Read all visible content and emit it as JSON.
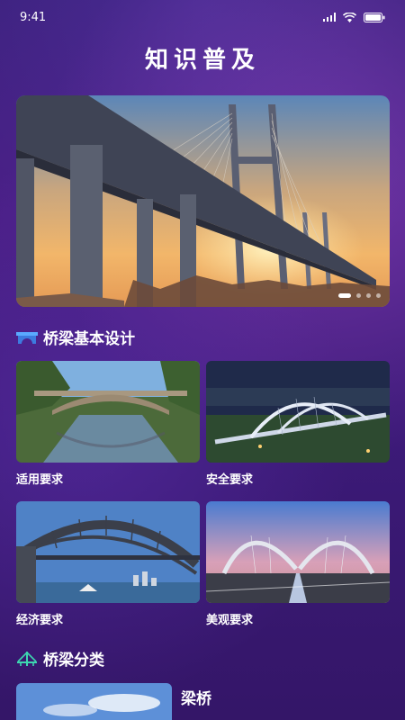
{
  "status_bar": {
    "time": "9:41"
  },
  "page": {
    "title": "知识普及"
  },
  "banner": {
    "slide_count": 4,
    "active_slide": 1
  },
  "sections": {
    "design": {
      "title": "桥梁基本设计",
      "icon": "bridge-icon",
      "cards": [
        {
          "label": "适用要求"
        },
        {
          "label": "安全要求"
        },
        {
          "label": "经济要求"
        },
        {
          "label": "美观要求"
        }
      ]
    },
    "classification": {
      "title": "桥梁分类",
      "icon": "suspension-bridge-icon",
      "items": [
        {
          "label": "梁桥"
        }
      ]
    }
  },
  "colors": {
    "background": "#3c1a78",
    "accent_icon": "#5aa9ff",
    "accent_icon_green": "#3dd6b0"
  }
}
